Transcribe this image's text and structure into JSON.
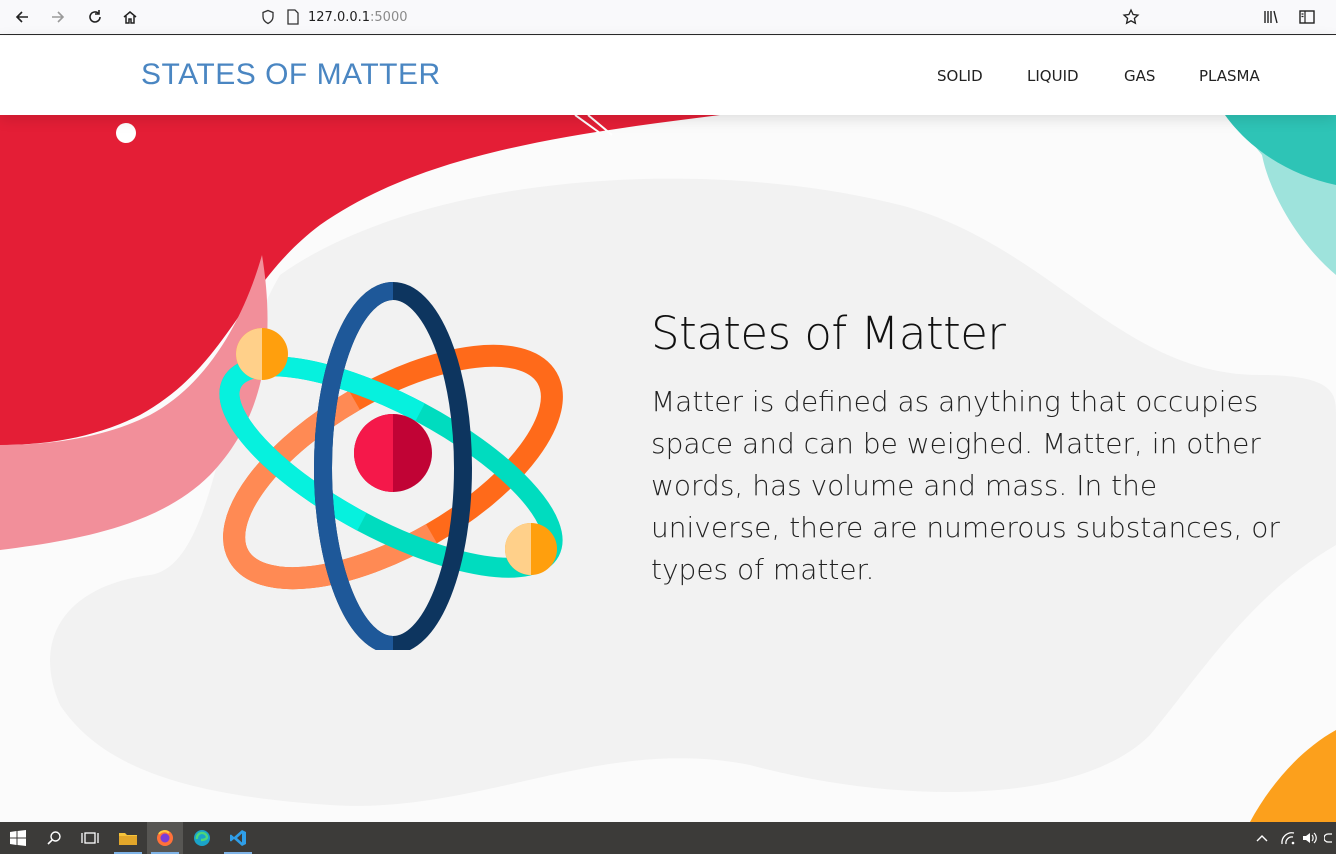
{
  "browser": {
    "url_host": "127.0.0.1",
    "url_port": ":5000",
    "icons": [
      "back-icon",
      "forward-icon",
      "reload-icon",
      "home-icon",
      "shield-icon",
      "page-icon",
      "star-icon",
      "library-icon",
      "sidebar-icon"
    ]
  },
  "site": {
    "brand": "STATES OF MATTER",
    "nav": [
      {
        "label": "SOLID"
      },
      {
        "label": "LIQUID"
      },
      {
        "label": "GAS"
      },
      {
        "label": "PLASMA"
      }
    ]
  },
  "hero": {
    "title": "States of Matter",
    "text": "Matter is defined as anything that occupies space and can be weighed. Matter, in other words, has volume and mass. In the universe, there are numerous substances, or types of matter."
  },
  "taskbar": {
    "icons": [
      "windows-start-icon",
      "search-icon",
      "task-view-icon",
      "file-explorer-icon",
      "firefox-icon",
      "edge-icon",
      "vscode-icon"
    ]
  },
  "colors": {
    "brand": "#4a86c2",
    "blob_red": "#e41e36",
    "blob_pink": "#f28f9a",
    "blob_teal": "#2ec4b6",
    "blob_orange": "#fca01c",
    "taskbar": "#3c3b39"
  }
}
